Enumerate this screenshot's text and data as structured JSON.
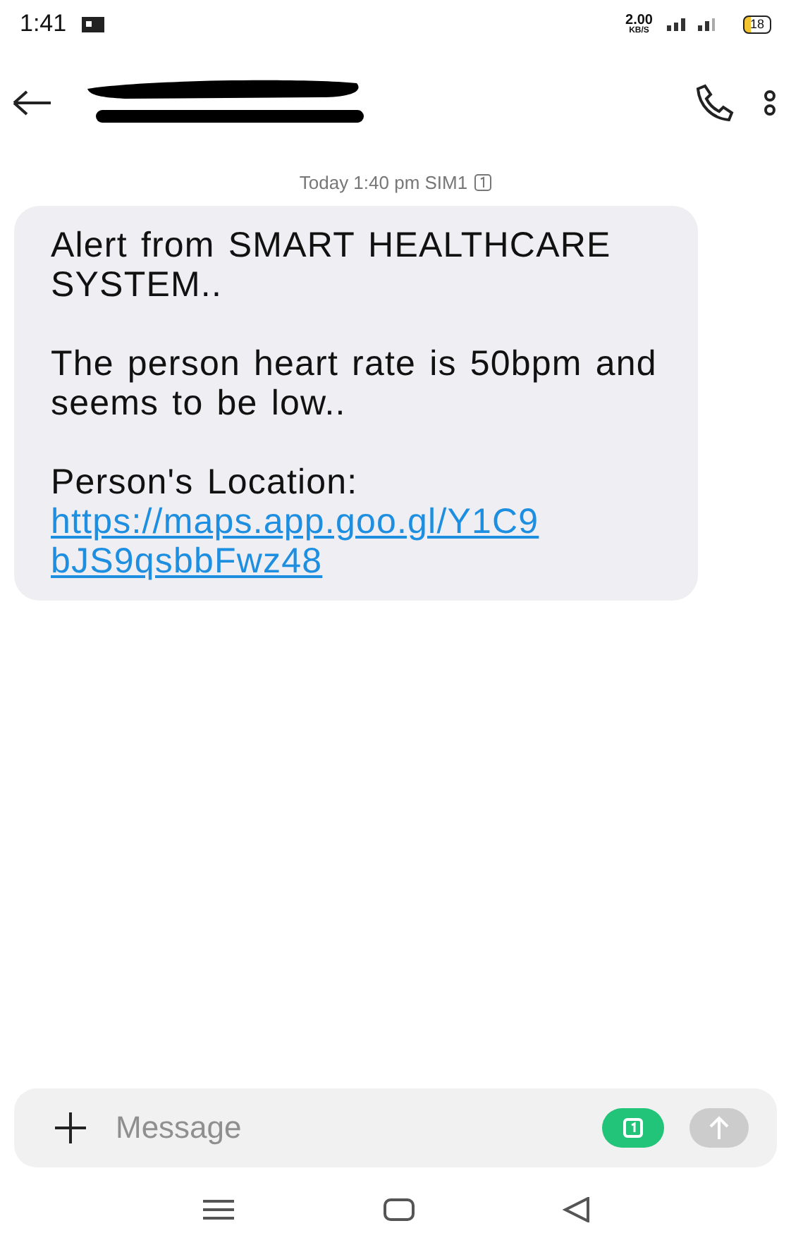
{
  "status_bar": {
    "time": "1:41",
    "speed": "2.00",
    "speed_unit": "KB/S",
    "battery": "18"
  },
  "header": {
    "contact_redacted": true
  },
  "timestamp": "Today 1:40 pm SIM1",
  "messages": [
    {
      "paragraphs": [
        "Alert from SMART HEALTHCARE SYSTEM..",
        "The  person heart rate is 50bpm and seems to be low..",
        "Person's Location:"
      ],
      "link": "https://maps.app.goo.gl/Y1C9bJS9qsbbFwz48"
    }
  ],
  "composer": {
    "placeholder": "Message",
    "sim_selected": true
  }
}
